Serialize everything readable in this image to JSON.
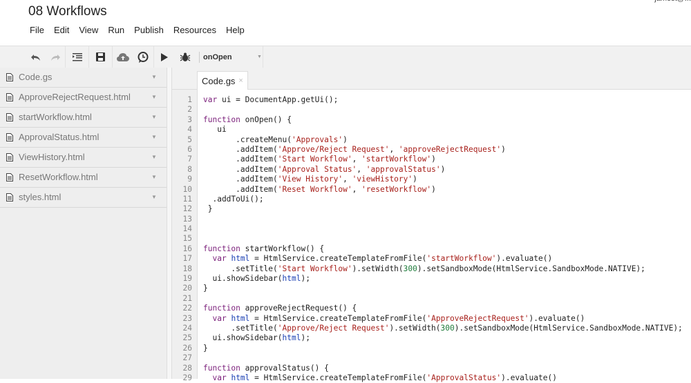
{
  "header": {
    "title": "08 Workflows",
    "user": "jamest@..."
  },
  "menu": [
    "File",
    "Edit",
    "View",
    "Run",
    "Publish",
    "Resources",
    "Help"
  ],
  "toolbar": {
    "icons": [
      "undo-icon",
      "redo-icon",
      "indent-icon",
      "save-icon",
      "deploy-cloud-icon",
      "triggers-clock-icon",
      "run-icon",
      "debug-bug-icon"
    ],
    "function_select": "onOpen"
  },
  "files": [
    {
      "name": "Code.gs"
    },
    {
      "name": "ApproveRejectRequest.html"
    },
    {
      "name": "startWorkflow.html"
    },
    {
      "name": "ApprovalStatus.html"
    },
    {
      "name": "ViewHistory.html"
    },
    {
      "name": "ResetWorkflow.html"
    },
    {
      "name": "styles.html"
    }
  ],
  "editor": {
    "active_tab": "Code.gs",
    "tab_close": "×",
    "lines": [
      [
        {
          "t": "kw",
          "v": "var"
        },
        {
          "t": "p",
          "v": " ui = DocumentApp.getUi();"
        }
      ],
      [],
      [
        {
          "t": "kw",
          "v": "function"
        },
        {
          "t": "p",
          "v": " onOpen() {"
        }
      ],
      [
        {
          "t": "p",
          "v": "   ui"
        }
      ],
      [
        {
          "t": "p",
          "v": "       .createMenu("
        },
        {
          "t": "str",
          "v": "'Approvals'"
        },
        {
          "t": "p",
          "v": ")"
        }
      ],
      [
        {
          "t": "p",
          "v": "       .addItem("
        },
        {
          "t": "str",
          "v": "'Approve/Reject Request'"
        },
        {
          "t": "p",
          "v": ", "
        },
        {
          "t": "str",
          "v": "'approveRejectRequest'"
        },
        {
          "t": "p",
          "v": ")"
        }
      ],
      [
        {
          "t": "p",
          "v": "       .addItem("
        },
        {
          "t": "str",
          "v": "'Start Workflow'"
        },
        {
          "t": "p",
          "v": ", "
        },
        {
          "t": "str",
          "v": "'startWorkflow'"
        },
        {
          "t": "p",
          "v": ")"
        }
      ],
      [
        {
          "t": "p",
          "v": "       .addItem("
        },
        {
          "t": "str",
          "v": "'Approval Status'"
        },
        {
          "t": "p",
          "v": ", "
        },
        {
          "t": "str",
          "v": "'approvalStatus'"
        },
        {
          "t": "p",
          "v": ")"
        }
      ],
      [
        {
          "t": "p",
          "v": "       .addItem("
        },
        {
          "t": "str",
          "v": "'View History'"
        },
        {
          "t": "p",
          "v": ", "
        },
        {
          "t": "str",
          "v": "'viewHistory'"
        },
        {
          "t": "p",
          "v": ")"
        }
      ],
      [
        {
          "t": "p",
          "v": "       .addItem("
        },
        {
          "t": "str",
          "v": "'Reset Workflow'"
        },
        {
          "t": "p",
          "v": ", "
        },
        {
          "t": "str",
          "v": "'resetWorkflow'"
        },
        {
          "t": "p",
          "v": ")"
        }
      ],
      [
        {
          "t": "p",
          "v": "  .addToUi();"
        }
      ],
      [
        {
          "t": "p",
          "v": " }"
        }
      ],
      [],
      [],
      [],
      [
        {
          "t": "kw",
          "v": "function"
        },
        {
          "t": "p",
          "v": " startWorkflow() {"
        }
      ],
      [
        {
          "t": "p",
          "v": "  "
        },
        {
          "t": "kw",
          "v": "var"
        },
        {
          "t": "p",
          "v": " "
        },
        {
          "t": "var",
          "v": "html"
        },
        {
          "t": "p",
          "v": " = HtmlService.createTemplateFromFile("
        },
        {
          "t": "str",
          "v": "'startWorkflow'"
        },
        {
          "t": "p",
          "v": ").evaluate()"
        }
      ],
      [
        {
          "t": "p",
          "v": "      .setTitle("
        },
        {
          "t": "str",
          "v": "'Start Workflow'"
        },
        {
          "t": "p",
          "v": ").setWidth("
        },
        {
          "t": "num",
          "v": "300"
        },
        {
          "t": "p",
          "v": ").setSandboxMode(HtmlService.SandboxMode.NATIVE);"
        }
      ],
      [
        {
          "t": "p",
          "v": "  ui.showSidebar("
        },
        {
          "t": "var",
          "v": "html"
        },
        {
          "t": "p",
          "v": ");"
        }
      ],
      [
        {
          "t": "p",
          "v": "}"
        }
      ],
      [],
      [
        {
          "t": "kw",
          "v": "function"
        },
        {
          "t": "p",
          "v": " approveRejectRequest() {"
        }
      ],
      [
        {
          "t": "p",
          "v": "  "
        },
        {
          "t": "kw",
          "v": "var"
        },
        {
          "t": "p",
          "v": " "
        },
        {
          "t": "var",
          "v": "html"
        },
        {
          "t": "p",
          "v": " = HtmlService.createTemplateFromFile("
        },
        {
          "t": "str",
          "v": "'ApproveRejectRequest'"
        },
        {
          "t": "p",
          "v": ").evaluate()"
        }
      ],
      [
        {
          "t": "p",
          "v": "      .setTitle("
        },
        {
          "t": "str",
          "v": "'Approve/Reject Request'"
        },
        {
          "t": "p",
          "v": ").setWidth("
        },
        {
          "t": "num",
          "v": "300"
        },
        {
          "t": "p",
          "v": ").setSandboxMode(HtmlService.SandboxMode.NATIVE);"
        }
      ],
      [
        {
          "t": "p",
          "v": "  ui.showSidebar("
        },
        {
          "t": "var",
          "v": "html"
        },
        {
          "t": "p",
          "v": ");"
        }
      ],
      [
        {
          "t": "p",
          "v": "}"
        }
      ],
      [],
      [
        {
          "t": "kw",
          "v": "function"
        },
        {
          "t": "p",
          "v": " approvalStatus() {"
        }
      ],
      [
        {
          "t": "p",
          "v": "  "
        },
        {
          "t": "kw",
          "v": "var"
        },
        {
          "t": "p",
          "v": " "
        },
        {
          "t": "var",
          "v": "html"
        },
        {
          "t": "p",
          "v": " = HtmlService.createTemplateFromFile("
        },
        {
          "t": "str",
          "v": "'ApprovalStatus'"
        },
        {
          "t": "p",
          "v": ").evaluate()"
        }
      ]
    ]
  }
}
